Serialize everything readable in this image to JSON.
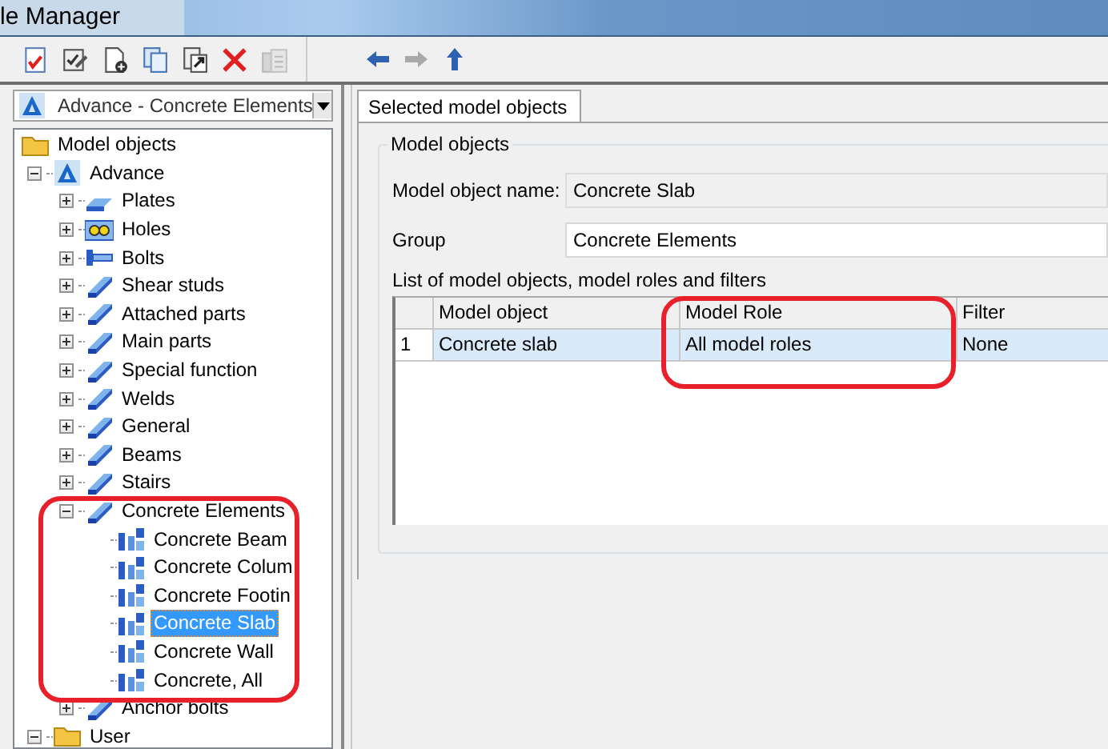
{
  "window": {
    "title": "le Manager"
  },
  "toolbar": {
    "buttons": [
      {
        "disabled": false
      },
      {
        "disabled": false
      },
      {
        "disabled": false
      },
      {
        "disabled": false
      },
      {
        "disabled": false
      },
      {
        "disabled": false
      },
      {
        "disabled": true
      }
    ]
  },
  "navigation": {
    "buttons": [
      {
        "disabled": false
      },
      {
        "disabled": true
      },
      {
        "disabled": false
      }
    ]
  },
  "selector": {
    "value": "Advance - Concrete Elements"
  },
  "tree": [
    {
      "label": "Model objects",
      "selected": false,
      "children": [
        {
          "label": "Advance",
          "expanded": true,
          "selected": false,
          "children": [
            {
              "label": "Plates",
              "expanded": false,
              "selected": false
            },
            {
              "label": "Holes",
              "expanded": false,
              "selected": false
            },
            {
              "label": "Bolts",
              "expanded": false,
              "selected": false
            },
            {
              "label": "Shear studs",
              "expanded": false,
              "selected": false
            },
            {
              "label": "Attached parts",
              "expanded": false,
              "selected": false
            },
            {
              "label": "Main parts",
              "expanded": false,
              "selected": false
            },
            {
              "label": "Special function",
              "expanded": false,
              "selected": false
            },
            {
              "label": "Welds",
              "expanded": false,
              "selected": false
            },
            {
              "label": "General",
              "expanded": false,
              "selected": false
            },
            {
              "label": "Beams",
              "expanded": false,
              "selected": false
            },
            {
              "label": "Stairs",
              "expanded": false,
              "selected": false
            },
            {
              "label": "Concrete Elements",
              "expanded": true,
              "selected": false,
              "children": [
                {
                  "label": "Concrete Beam",
                  "selected": false
                },
                {
                  "label": "Concrete Colum",
                  "selected": false
                },
                {
                  "label": "Concrete Footin",
                  "selected": false
                },
                {
                  "label": "Concrete Slab",
                  "selected": true
                },
                {
                  "label": "Concrete Wall",
                  "selected": false
                },
                {
                  "label": "Concrete, All",
                  "selected": false
                }
              ]
            },
            {
              "label": "Anchor bolts",
              "expanded": false,
              "selected": false
            }
          ]
        },
        {
          "label": "User",
          "expanded": true,
          "selected": false
        }
      ]
    }
  ],
  "tabs": [
    {
      "label": "Selected model objects",
      "selected": true
    }
  ],
  "group": {
    "title": "Model objects",
    "fields": [
      {
        "label": "Model object name:",
        "value": "Concrete Slab",
        "disabled": true
      },
      {
        "label": "Group",
        "value": "Concrete Elements",
        "disabled": false
      }
    ],
    "list_label": "List of model objects, model roles and filters",
    "table": {
      "columns": [
        "Model object",
        "Model Role",
        "Filter"
      ],
      "rows": [
        {
          "number": "1",
          "cells": [
            "Concrete slab",
            "All model roles",
            "None"
          ],
          "selected": true
        }
      ]
    }
  }
}
